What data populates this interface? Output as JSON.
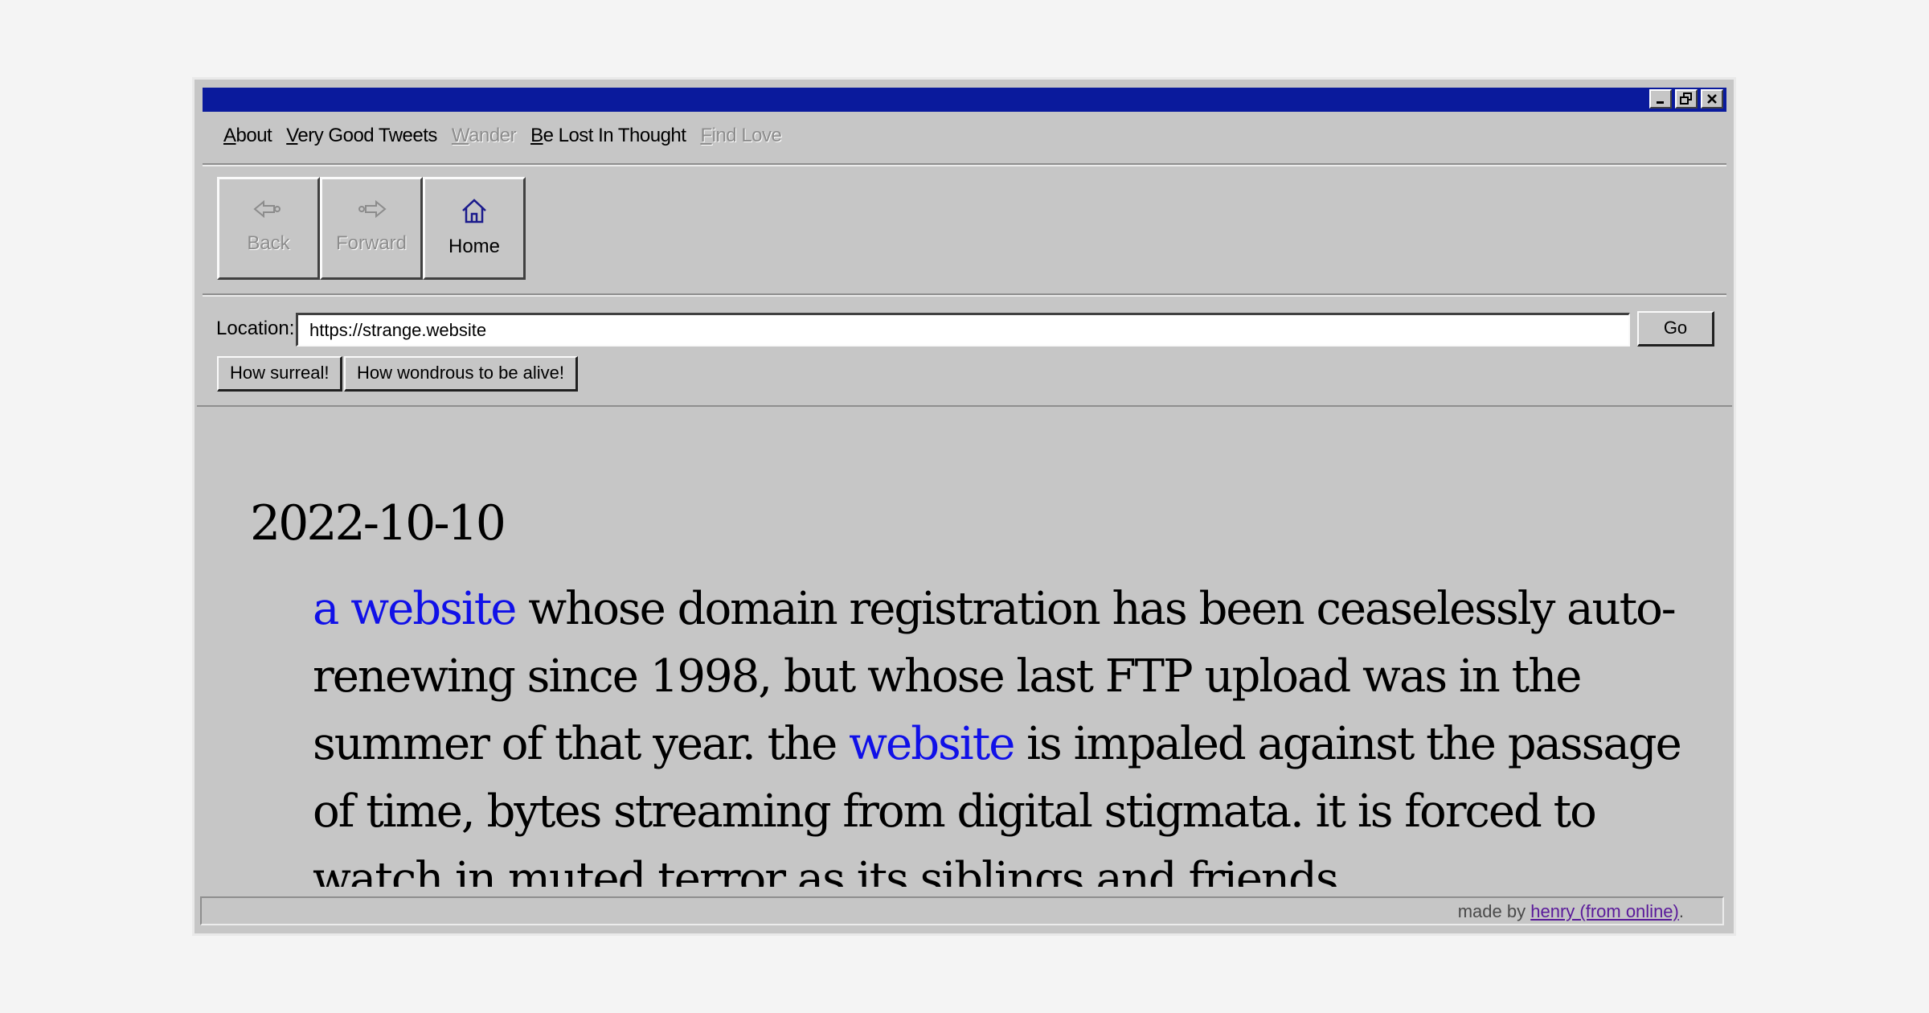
{
  "menu": {
    "items": [
      {
        "acc": "A",
        "rest": "bout",
        "enabled": true
      },
      {
        "acc": "V",
        "rest": "ery Good Tweets",
        "enabled": true
      },
      {
        "acc": "W",
        "rest": "ander",
        "enabled": false
      },
      {
        "acc": "B",
        "rest": "e Lost In Thought",
        "enabled": true
      },
      {
        "acc": "F",
        "rest": "ind Love",
        "enabled": false
      }
    ]
  },
  "toolbar": {
    "back_label": "Back",
    "forward_label": "Forward",
    "home_label": "Home"
  },
  "location": {
    "label": "Location:",
    "value": "https://strange.website",
    "go_label": "Go"
  },
  "quick_buttons": [
    "How surreal!",
    "How wondrous to be alive!"
  ],
  "post": {
    "date": "2022-10-10",
    "link1": "a website",
    "text1": " whose domain registration has been ceaselessly auto-renewing since 1998, but whose last FTP upload was in the summer of that year. the ",
    "link2": "website",
    "text2": " is impaled against the passage of time, bytes streaming from digital stigmata. it is forced to watch in muted terror as its siblings and friends"
  },
  "status": {
    "prefix": "made by ",
    "credit": "henry (from online)",
    "suffix": "."
  },
  "colors": {
    "titlebar": "#0a1a9c",
    "link": "#1010e8",
    "visited_link": "#5a1a9a",
    "chrome": "#c6c6c6"
  }
}
